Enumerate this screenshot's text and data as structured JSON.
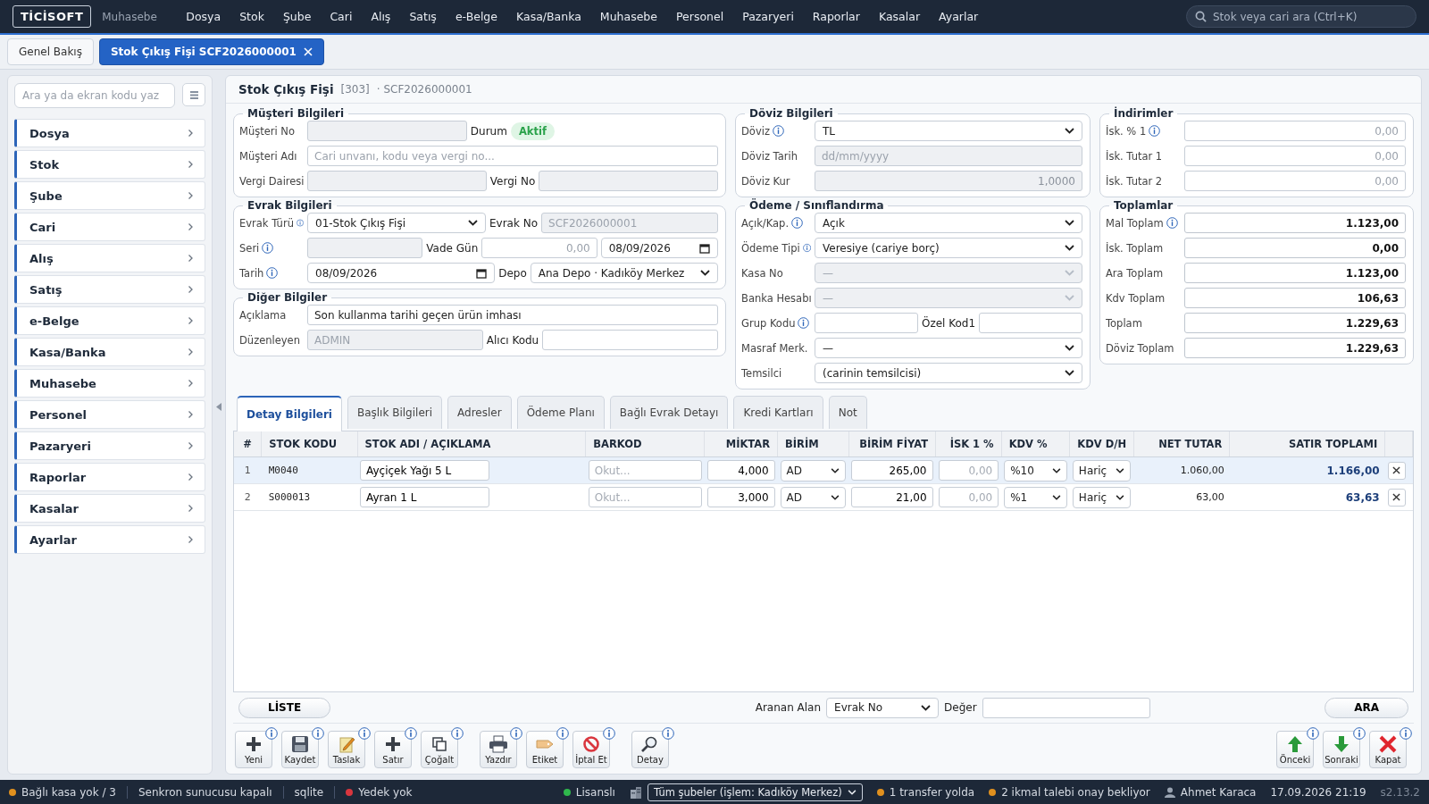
{
  "topbar": {
    "logo": "TİCİSOFT",
    "module": "Muhasebe",
    "menu": [
      "Dosya",
      "Stok",
      "Şube",
      "Cari",
      "Alış",
      "Satış",
      "e-Belge",
      "Kasa/Banka",
      "Muhasebe",
      "Personel",
      "Pazaryeri",
      "Raporlar",
      "Kasalar",
      "Ayarlar"
    ],
    "search": {
      "placeholder": "Stok veya cari ara (Ctrl+K)"
    }
  },
  "tabs": [
    {
      "label": "Genel Bakış",
      "selected": false,
      "closable": false
    },
    {
      "label": "Stok Çıkış Fişi SCF2026000001",
      "selected": true,
      "closable": true
    }
  ],
  "sidebar": {
    "search": {
      "placeholder": "Ara ya da ekran kodu yaz"
    },
    "items": [
      {
        "label": "Dosya"
      },
      {
        "label": "Stok"
      },
      {
        "label": "Şube"
      },
      {
        "label": "Cari"
      },
      {
        "label": "Alış"
      },
      {
        "label": "Satış"
      },
      {
        "label": "e-Belge"
      },
      {
        "label": "Kasa/Banka"
      },
      {
        "label": "Muhasebe"
      },
      {
        "label": "Personel"
      },
      {
        "label": "Pazaryeri"
      },
      {
        "label": "Raporlar"
      },
      {
        "label": "Kasalar"
      },
      {
        "label": "Ayarlar"
      }
    ]
  },
  "form": {
    "title": "Stok Çıkış Fişi",
    "code": "[303]",
    "number": "· SCF2026000001",
    "columns": [
      [
        {
          "title": "Müşteri Bilgileri",
          "rows": [
            [
              {
                "kind": "label",
                "text": "Müşteri No"
              },
              {
                "kind": "input",
                "disabled": true
              },
              {
                "kind": "label",
                "text": "Durum"
              },
              {
                "kind": "badge",
                "text": "Aktif"
              },
              {
                "kind": "spacer"
              }
            ],
            [
              {
                "kind": "label",
                "text": "Müşteri Adı"
              },
              {
                "kind": "input",
                "placeholder": "Cari unvanı, kodu veya vergi no...",
                "disabled": false
              }
            ],
            [
              {
                "kind": "label",
                "text": "Vergi Dairesi"
              },
              {
                "kind": "input",
                "disabled": true
              },
              {
                "kind": "label",
                "text": "Vergi No"
              },
              {
                "kind": "input",
                "disabled": true
              }
            ]
          ]
        },
        {
          "title": "Evrak Bilgileri",
          "rows": [
            [
              {
                "kind": "label",
                "text": "Evrak Türü",
                "info": true
              },
              {
                "kind": "select",
                "value": "01-Stok Çıkış Fişi",
                "disabled": false
              },
              {
                "kind": "label",
                "text": "Evrak No"
              },
              {
                "kind": "input",
                "placeholder": "SCF2026000001",
                "disabled": true
              }
            ],
            [
              {
                "kind": "label",
                "text": "Seri",
                "info": true
              },
              {
                "kind": "input",
                "disabled": true
              },
              {
                "kind": "label",
                "text": "Vade Gün"
              },
              {
                "kind": "number",
                "placeholder": "0,00",
                "disabled": false
              },
              {
                "kind": "date",
                "value": "08/09/2026"
              }
            ],
            [
              {
                "kind": "label",
                "text": "Tarih",
                "info": true
              },
              {
                "kind": "date",
                "value": "08/09/2026"
              },
              {
                "kind": "label",
                "text": "Depo"
              },
              {
                "kind": "select",
                "value": "Ana Depo · Kadıköy Merkez",
                "disabled": false
              }
            ]
          ]
        },
        {
          "title": "Diğer Bilgiler",
          "rows": [
            [
              {
                "kind": "label",
                "text": "Açıklama"
              },
              {
                "kind": "input",
                "value": "Son kullanma tarihi geçen ürün imhası",
                "disabled": false
              }
            ],
            [
              {
                "kind": "label",
                "text": "Düzenleyen"
              },
              {
                "kind": "input",
                "placeholder": "ADMIN",
                "disabled": true
              },
              {
                "kind": "label",
                "text": "Alıcı Kodu"
              },
              {
                "kind": "input",
                "disabled": false
              }
            ]
          ]
        }
      ],
      [
        {
          "title": "Döviz Bilgileri",
          "rows": [
            [
              {
                "kind": "label",
                "text": "Döviz",
                "info": true
              },
              {
                "kind": "select",
                "value": "TL",
                "disabled": false
              }
            ],
            [
              {
                "kind": "label",
                "text": "Döviz Tarih"
              },
              {
                "kind": "input",
                "placeholder": "dd/mm/yyyy",
                "disabled": true
              }
            ],
            [
              {
                "kind": "label",
                "text": "Döviz Kur"
              },
              {
                "kind": "number",
                "value": "1,0000",
                "disabled": true
              }
            ]
          ]
        },
        {
          "title": "Ödeme / Sınıflandırma",
          "rows": [
            [
              {
                "kind": "label",
                "text": "Açık/Kap.",
                "info": true
              },
              {
                "kind": "select",
                "value": "Açık",
                "disabled": false
              }
            ],
            [
              {
                "kind": "label",
                "text": "Ödeme Tipi",
                "info": true
              },
              {
                "kind": "select",
                "value": "Veresiye (cariye borç)",
                "disabled": false
              }
            ],
            [
              {
                "kind": "label",
                "text": "Kasa No"
              },
              {
                "kind": "select",
                "value": "—",
                "disabled": true
              }
            ],
            [
              {
                "kind": "label",
                "text": "Banka Hesabı"
              },
              {
                "kind": "select",
                "value": "—",
                "disabled": true
              }
            ],
            [
              {
                "kind": "label",
                "text": "Grup Kodu",
                "info": true
              },
              {
                "kind": "input",
                "disabled": false
              },
              {
                "kind": "label",
                "text": "Özel Kod1"
              },
              {
                "kind": "input",
                "disabled": false
              }
            ],
            [
              {
                "kind": "label",
                "text": "Masraf Merk."
              },
              {
                "kind": "select",
                "value": "—",
                "disabled": false
              }
            ],
            [
              {
                "kind": "label",
                "text": "Temsilci"
              },
              {
                "kind": "select",
                "value": "(carinin temsilcisi)",
                "disabled": false
              }
            ]
          ]
        }
      ],
      [
        {
          "title": "İndirimler",
          "rows": [
            [
              {
                "kind": "label",
                "text": "İsk. % 1",
                "info": true
              },
              {
                "kind": "number",
                "placeholder": "0,00",
                "disabled": false
              }
            ],
            [
              {
                "kind": "label",
                "text": "İsk. Tutar 1"
              },
              {
                "kind": "number",
                "placeholder": "0,00",
                "disabled": false
              }
            ],
            [
              {
                "kind": "label",
                "text": "İsk. Tutar 2"
              },
              {
                "kind": "number",
                "placeholder": "0,00",
                "disabled": false
              }
            ]
          ]
        },
        {
          "title": "Toplamlar",
          "rows": [
            [
              {
                "kind": "label",
                "text": "Mal Toplam",
                "info": true
              },
              {
                "kind": "total",
                "value": "1.123,00"
              }
            ],
            [
              {
                "kind": "label",
                "text": "İsk. Toplam"
              },
              {
                "kind": "total",
                "value": "0,00"
              }
            ],
            [
              {
                "kind": "label",
                "text": "Ara Toplam"
              },
              {
                "kind": "total",
                "value": "1.123,00"
              }
            ],
            [
              {
                "kind": "label",
                "text": "Kdv Toplam"
              },
              {
                "kind": "total",
                "value": "106,63"
              }
            ],
            [
              {
                "kind": "label",
                "text": "Toplam"
              },
              {
                "kind": "total",
                "value": "1.229,63"
              }
            ],
            [
              {
                "kind": "label",
                "text": "Döviz Toplam"
              },
              {
                "kind": "total",
                "value": "1.229,63"
              }
            ]
          ]
        }
      ]
    ]
  },
  "detail_tabs": [
    {
      "label": "Detay Bilgileri",
      "selected": true
    },
    {
      "label": "Başlık Bilgileri",
      "selected": false
    },
    {
      "label": "Adresler",
      "selected": false
    },
    {
      "label": "Ödeme Planı",
      "selected": false
    },
    {
      "label": "Bağlı Evrak Detayı",
      "selected": false
    },
    {
      "label": "Kredi Kartları",
      "selected": false
    },
    {
      "label": "Not",
      "selected": false
    }
  ],
  "table": {
    "columns": [
      "#",
      "STOK KODU",
      "STOK ADI / AÇIKLAMA",
      "BARKOD",
      "MİKTAR",
      "BİRİM",
      "BİRİM FİYAT",
      "İSK 1 %",
      "KDV %",
      "KDV D/H",
      "NET TUTAR",
      "SATIR TOPLAMI"
    ],
    "rows": [
      {
        "no": "1",
        "code": "M0040",
        "name": "Ayçiçek Yağı 5 L",
        "barcode_placeholder": "Okut...",
        "qty": "4,000",
        "unit": "AD",
        "price": "265,00",
        "discount_placeholder": "0,00",
        "vat": "%10",
        "vat_type": "Hariç",
        "net": "1.060,00",
        "total": "1.166,00",
        "selected": true
      },
      {
        "no": "2",
        "code": "S000013",
        "name": "Ayran 1 L",
        "barcode_placeholder": "Okut...",
        "qty": "3,000",
        "unit": "AD",
        "price": "21,00",
        "discount_placeholder": "0,00",
        "vat": "%1",
        "vat_type": "Hariç",
        "net": "63,00",
        "total": "63,63",
        "selected": false
      }
    ]
  },
  "search_bar": {
    "list_button": "LİSTE",
    "field_label": "Aranan Alan",
    "field_value": "Evrak No",
    "value_label": "Değer",
    "search_button": "ARA"
  },
  "toolbar": {
    "left": [
      [
        {
          "kind": "new",
          "label": "Yeni",
          "info": true
        },
        {
          "kind": "save",
          "label": "Kaydet",
          "info": true
        },
        {
          "kind": "draft",
          "label": "Taslak",
          "info": true
        },
        {
          "kind": "row",
          "label": "Satır",
          "info": true
        },
        {
          "kind": "copy",
          "label": "Çoğalt",
          "info": true
        }
      ],
      [
        {
          "kind": "print",
          "label": "Yazdır",
          "info": true
        },
        {
          "kind": "tag",
          "label": "Etiket",
          "info": true
        },
        {
          "kind": "cancel",
          "label": "İptal Et",
          "info": true
        }
      ],
      [
        {
          "kind": "detail",
          "label": "Detay",
          "info": true
        }
      ]
    ],
    "right": [
      {
        "kind": "prev",
        "label": "Önceki",
        "info": true
      },
      {
        "kind": "next",
        "label": "Sonraki",
        "info": true
      },
      {
        "kind": "close",
        "label": "Kapat",
        "info": true
      }
    ]
  },
  "status": {
    "left": [
      {
        "kind": "dot",
        "text": "Bağlı kasa yok / 3",
        "color": "#e0901e"
      },
      {
        "kind": "text",
        "text": "Senkron sunucusu kapalı"
      },
      {
        "kind": "text",
        "text": "sqlite"
      },
      {
        "kind": "dot",
        "text": "Yedek yok",
        "color": "#d9363e"
      }
    ],
    "right": [
      {
        "kind": "dot",
        "text": "Lisanslı",
        "color": "#2fb84c"
      },
      {
        "kind": "select",
        "text": "Tüm şubeler (işlem: Kadıköy Merkez)"
      },
      {
        "kind": "dot",
        "text": "1 transfer yolda",
        "color": "#e0901e"
      },
      {
        "kind": "dot",
        "text": "2 ikmal talebi onay bekliyor",
        "color": "#e0901e"
      },
      {
        "kind": "user",
        "text": "Ahmet Karaca"
      },
      {
        "kind": "text",
        "text": "17.09.2026 21:19"
      },
      {
        "kind": "version",
        "text": "s2.13.2"
      }
    ]
  }
}
